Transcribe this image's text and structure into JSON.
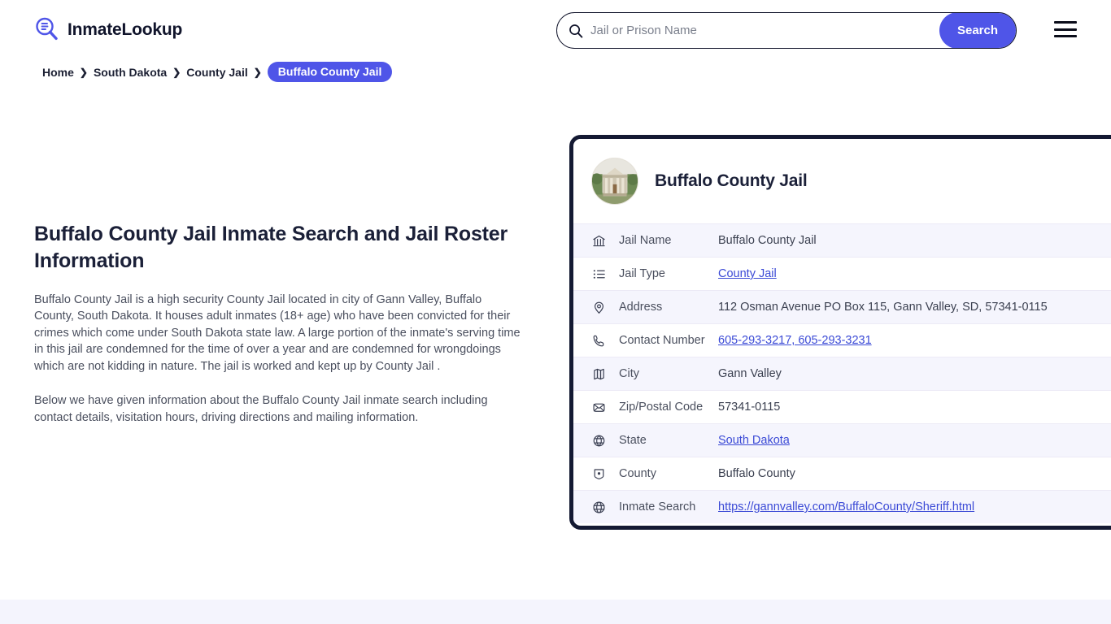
{
  "header": {
    "brand_name": "InmateLookup",
    "brand_icon": "magnifier-list-icon",
    "search": {
      "placeholder": "Jail or Prison Name",
      "value": "",
      "icon": "search-icon",
      "button_label": "Search"
    },
    "menu_icon": "hamburger-menu-icon"
  },
  "breadcrumb": {
    "items": [
      {
        "label": "Home",
        "active": false
      },
      {
        "label": "South Dakota",
        "active": false
      },
      {
        "label": "County Jail",
        "active": false
      },
      {
        "label": "Buffalo County Jail",
        "active": true
      }
    ],
    "separator": "❯"
  },
  "article": {
    "title": "Buffalo County Jail Inmate Search and Jail Roster Information",
    "paragraph1": "Buffalo County Jail is a high security County Jail located in city of Gann Valley, Buffalo County, South Dakota. It houses adult inmates (18+ age) who have been convicted for their crimes which come under South Dakota state law. A large portion of the inmate's serving time in this jail are condemned for the time of over a year and are condemned for wrongdoings which are not kidding in nature. The jail is worked and kept up by County Jail .",
    "paragraph2": "Below we have given information about the Buffalo County Jail inmate search including contact details, visitation hours, driving directions and mailing information."
  },
  "card": {
    "avatar_icon": "courthouse-photo",
    "title": "Buffalo County Jail",
    "rows": [
      {
        "icon": "bank-icon",
        "label": "Jail Name",
        "value": "Buffalo County Jail",
        "is_link": false
      },
      {
        "icon": "list-icon",
        "label": "Jail Type",
        "value": "County Jail",
        "is_link": true
      },
      {
        "icon": "location-pin-icon",
        "label": "Address",
        "value": "112 Osman Avenue PO Box 115, Gann Valley, SD, 57341-0115",
        "is_link": false
      },
      {
        "icon": "phone-icon",
        "label": "Contact Number",
        "value": "605-293-3217, 605-293-3231",
        "is_link": true
      },
      {
        "icon": "map-icon",
        "label": "City",
        "value": "Gann Valley",
        "is_link": false
      },
      {
        "icon": "envelope-icon",
        "label": "Zip/Postal Code",
        "value": "57341-0115",
        "is_link": false
      },
      {
        "icon": "globe-pin-icon",
        "label": "State",
        "value": "South Dakota",
        "is_link": true
      },
      {
        "icon": "county-icon",
        "label": "County",
        "value": "Buffalo County",
        "is_link": false
      },
      {
        "icon": "globe-icon",
        "label": "Inmate Search",
        "value": "https://gannvalley.com/BuffaloCounty/Sheriff.html",
        "is_link": true
      }
    ]
  },
  "colors": {
    "accent": "#4f55e8",
    "card_border": "#141a33",
    "link": "#3b4ad6",
    "row_alt_bg": "#f5f5fd",
    "footer_bg": "#f4f4fd",
    "heading": "#1b2038"
  }
}
